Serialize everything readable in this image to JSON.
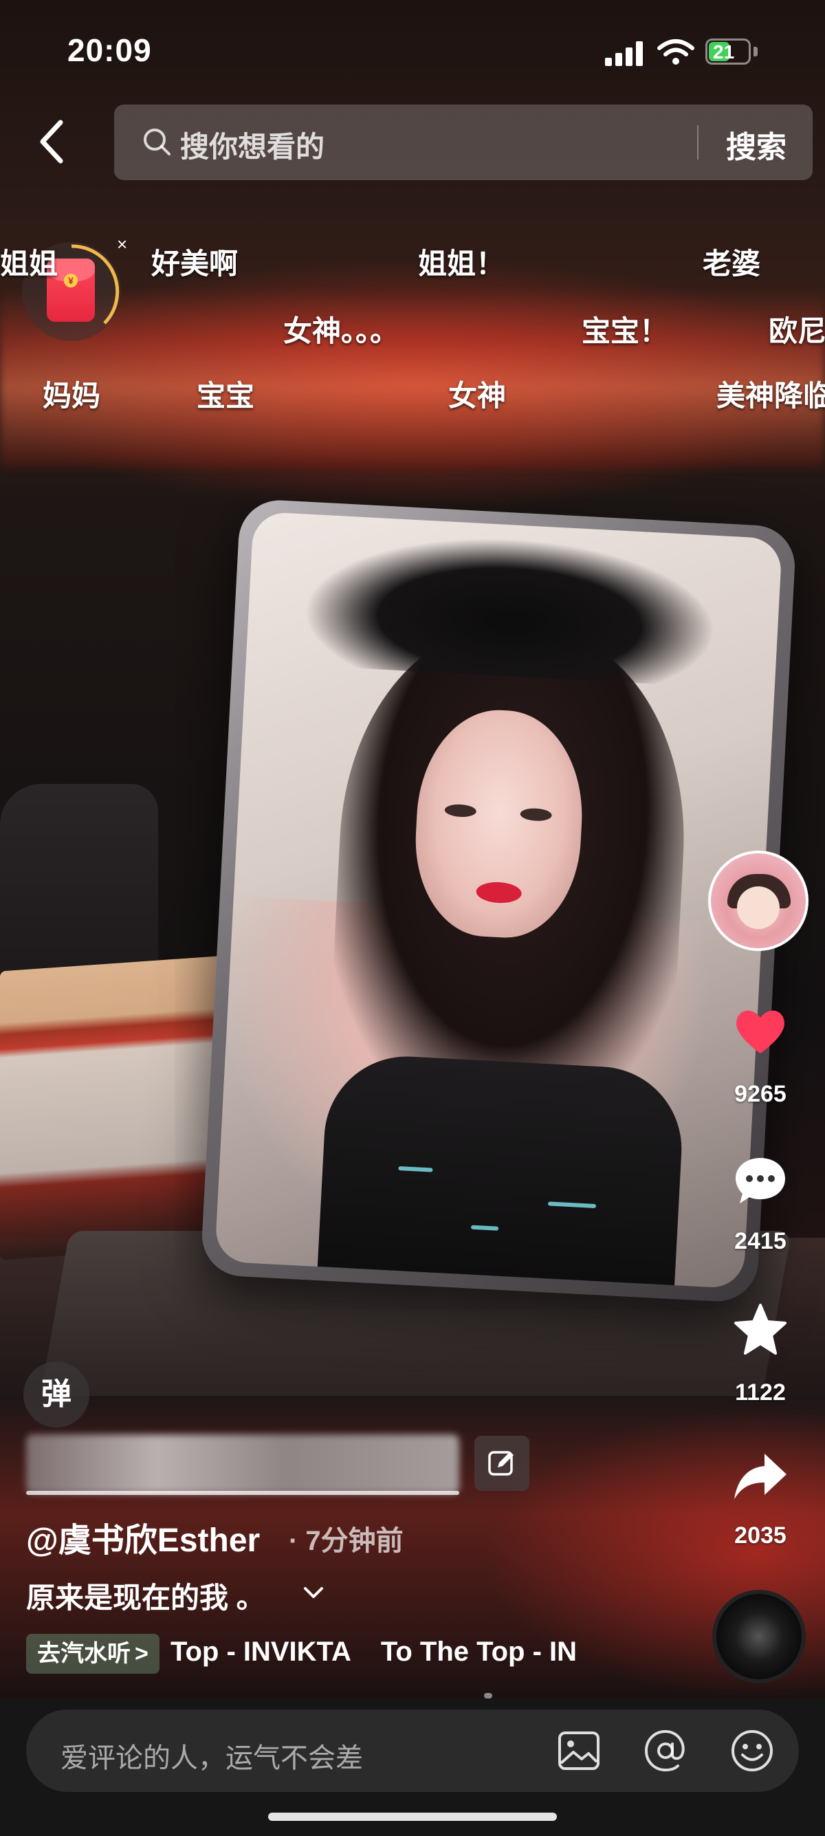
{
  "status_bar": {
    "time": "20:09",
    "battery_level": "21",
    "battery_color": "#43d05a"
  },
  "header": {
    "search_placeholder": "搜你想看的",
    "search_button": "搜索"
  },
  "danmaku": {
    "row1": [
      "姐姐",
      "好美啊",
      "姐姐！",
      "老婆"
    ],
    "row2": [
      "女神。。。",
      "宝宝！",
      "欧尼"
    ],
    "row3": [
      "妈妈",
      "宝宝",
      "女神",
      "美神降临"
    ]
  },
  "red_packet": {
    "close_symbol": "×",
    "coin_symbol": "¥"
  },
  "actions": {
    "like_count": "9265",
    "comment_count": "2415",
    "favorite_count": "1122",
    "share_count": "2035",
    "like_color": "#ff3b5c"
  },
  "post": {
    "danmu_toggle_label": "弹",
    "author": "@虞书欣Esther",
    "time_ago": "· 7分钟前",
    "caption": "原来是现在的我 。",
    "music_source_label": "去汽水听",
    "music_source_arrow": ">",
    "music_title": "Top - INVIKTA    To The Top - IN"
  },
  "comment_bar": {
    "placeholder": "爱评论的人，运气不会差"
  },
  "icons": {
    "back": "back-arrow-icon",
    "search": "search-icon",
    "like": "heart-icon",
    "comment": "comment-bubble-icon",
    "favorite": "star-icon",
    "share": "share-arrow-icon",
    "image": "image-icon",
    "mention": "at-icon",
    "emoji": "emoji-icon",
    "edit": "edit-icon"
  }
}
